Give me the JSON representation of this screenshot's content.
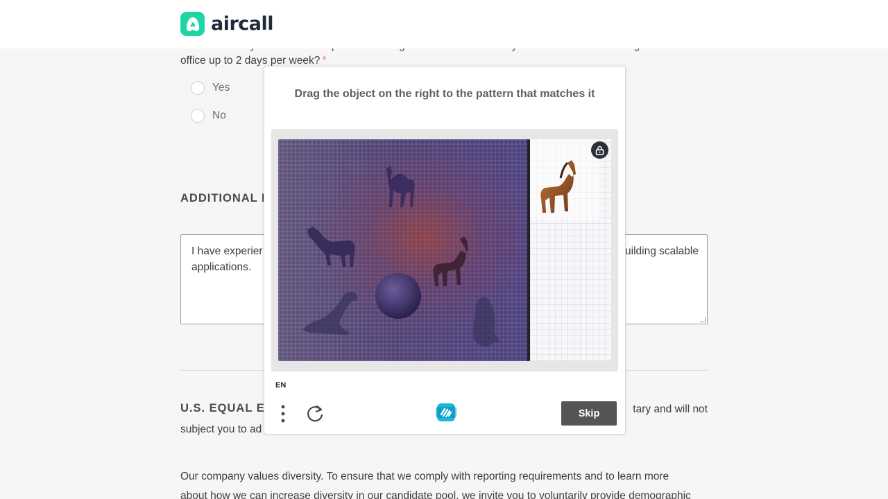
{
  "header": {
    "logo_text": "aircall"
  },
  "form": {
    "question_line1": "This role is a hybrid role and requires some regular in-office time. Are you comfortable with being in the",
    "question_line2": "office up to 2 days per week?",
    "required_mark": "*",
    "options": [
      "Yes",
      "No"
    ],
    "additional_heading": "ADDITIONAL I",
    "additional_text_line1": "I have experier",
    "additional_text_line1_end": "uilding scalable",
    "additional_text_line2": "applications.",
    "eeo_heading": "U.S. EQUAL EM",
    "eeo_line1_end": "tary and will not",
    "eeo_line2": "subject you to ad",
    "diversity_line1": "Our company values diversity. To ensure that we comply with reporting requirements and to learn more",
    "diversity_line2": "about how we can increase diversity in our candidate pool, we invite you to voluntarily provide demographic"
  },
  "captcha": {
    "prompt": "Drag the object on the right to the pattern that matches it",
    "language": "EN",
    "skip_label": "Skip",
    "icons": {
      "lock": "lock-icon",
      "menu": "kebab-menu-icon",
      "refresh": "refresh-icon",
      "brand": "hcaptcha-logo-icon"
    },
    "board_objects": [
      "camel",
      "horse",
      "horse",
      "sphere",
      "seal",
      "penguin"
    ],
    "drag_object": "horse",
    "colors": {
      "skip_button": "#555555",
      "board_base": "#5b4b82",
      "object_silhouette": "#2f2758",
      "object_highlight": "#5a2a18",
      "drag_horse": "#8b4a22"
    }
  }
}
